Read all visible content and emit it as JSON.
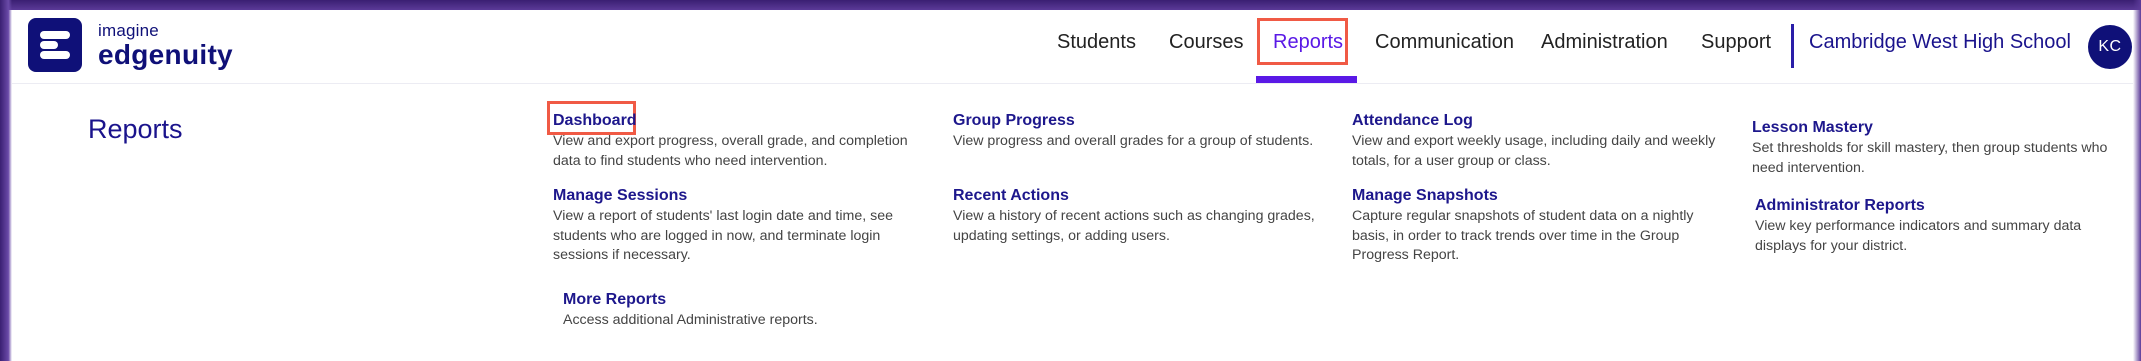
{
  "brand": {
    "line1": "imagine",
    "line2": "edgenuity"
  },
  "nav": {
    "items": [
      "Students",
      "Courses",
      "Reports",
      "Communication",
      "Administration",
      "Support"
    ],
    "active": "Reports",
    "school": "Cambridge West High School",
    "avatar_initials": "KC"
  },
  "colors": {
    "brand_navy": "#0f1078",
    "accent_purple": "#5a19e6",
    "highlight_red": "#f05a45"
  },
  "reports": {
    "title": "Reports",
    "items": [
      {
        "title": "Dashboard",
        "desc": "View and export progress, overall grade, and completion data to find students who need intervention."
      },
      {
        "title": "Manage Sessions",
        "desc": "View a report of students' last login date and time, see students who are logged in now, and terminate login sessions if necessary."
      },
      {
        "title": "More Reports",
        "desc": "Access additional Administrative reports."
      },
      {
        "title": "Group Progress",
        "desc": "View progress and overall grades for a group of students."
      },
      {
        "title": "Recent Actions",
        "desc": "View a history of recent actions such as changing grades, updating settings, or adding users."
      },
      {
        "title": "Attendance Log",
        "desc": "View and export weekly usage, including daily and weekly totals, for a user group or class."
      },
      {
        "title": "Manage Snapshots",
        "desc": "Capture regular snapshots of student data on a nightly basis, in order to track trends over time in the Group Progress Report."
      },
      {
        "title": "Lesson Mastery",
        "desc": "Set thresholds for skill mastery, then group students who need intervention."
      },
      {
        "title": "Administrator Reports",
        "desc": "View key performance indicators and summary data displays for your district."
      }
    ]
  }
}
